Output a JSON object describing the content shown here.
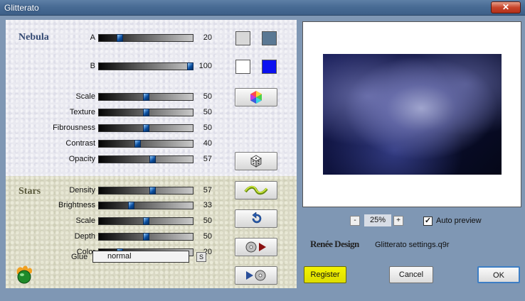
{
  "window": {
    "title": "Glitterato",
    "close_label": "✕"
  },
  "nebula": {
    "title": "Nebula",
    "sliders": [
      {
        "label": "A",
        "value": 20,
        "fraction": 0.2
      },
      {
        "label": "B",
        "value": 100,
        "fraction": 1.0
      },
      {
        "label": "Scale",
        "value": 50,
        "fraction": 0.5
      },
      {
        "label": "Texture",
        "value": 50,
        "fraction": 0.5
      },
      {
        "label": "Fibrousness",
        "value": 50,
        "fraction": 0.5
      },
      {
        "label": "Contrast",
        "value": 40,
        "fraction": 0.4
      },
      {
        "label": "Opacity",
        "value": 57,
        "fraction": 0.57
      }
    ],
    "colors": {
      "a_left": "#d8d8d8",
      "a_right": "#5a7894",
      "b_left": "#ffffff",
      "b_right": "#0a10f0"
    }
  },
  "stars": {
    "title": "Stars",
    "sliders": [
      {
        "label": "Density",
        "value": 57,
        "fraction": 0.57
      },
      {
        "label": "Brightness",
        "value": 33,
        "fraction": 0.33
      },
      {
        "label": "Scale",
        "value": 50,
        "fraction": 0.5
      },
      {
        "label": "Depth",
        "value": 50,
        "fraction": 0.5
      },
      {
        "label": "Color",
        "value": 20,
        "fraction": 0.2
      }
    ]
  },
  "glue": {
    "label": "Glue",
    "value": "normal",
    "s_label": "S"
  },
  "icons": [
    "color-wheel-icon",
    "dice-icon",
    "wave-icon",
    "reset-icon",
    "load-preset-icon",
    "save-preset-icon",
    "program-logo-icon"
  ],
  "preview": {
    "zoom": "25%",
    "minus": "-",
    "plus": "+",
    "auto_preview_label": "Auto preview",
    "auto_preview_checked": true,
    "check_mark": "✓"
  },
  "branding": {
    "logo_text": "Renée Design",
    "settings_file": "Glitterato settings.q9r"
  },
  "buttons": {
    "register": "Register",
    "cancel": "Cancel",
    "ok": "OK"
  }
}
